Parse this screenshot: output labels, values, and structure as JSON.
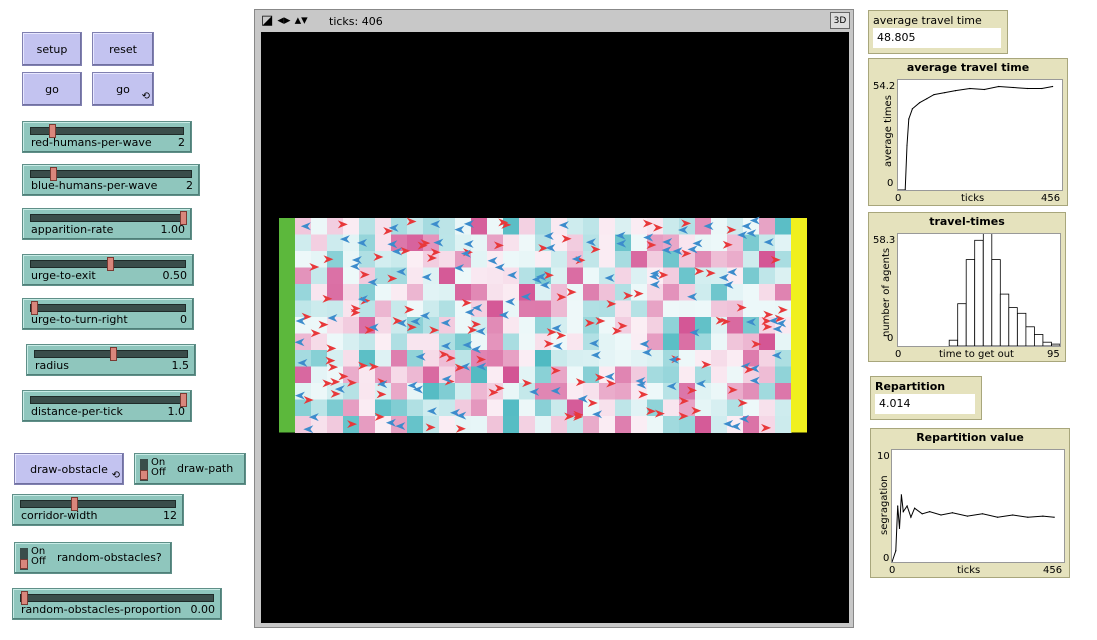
{
  "buttons": {
    "setup": "setup",
    "reset": "reset",
    "go_once": "go",
    "go_forever": "go",
    "draw_obstacle": "draw-obstacle",
    "forever_glyph": "⟲"
  },
  "sliders": [
    {
      "id": "red-humans-per-wave",
      "label": "red-humans-per-wave",
      "value": "2",
      "fraction": 0.12
    },
    {
      "id": "blue-humans-per-wave",
      "label": "blue-humans-per-wave",
      "value": "2",
      "fraction": 0.12
    },
    {
      "id": "apparition-rate",
      "label": "apparition-rate",
      "value": "1.00",
      "fraction": 1.0
    },
    {
      "id": "urge-to-exit",
      "label": "urge-to-exit",
      "value": "0.50",
      "fraction": 0.5
    },
    {
      "id": "urge-to-turn-right",
      "label": "urge-to-turn-right",
      "value": "0",
      "fraction": 0.0
    },
    {
      "id": "radius",
      "label": "radius",
      "value": "1.5",
      "fraction": 0.5
    },
    {
      "id": "distance-per-tick",
      "label": "distance-per-tick",
      "value": "1.0",
      "fraction": 1.0
    },
    {
      "id": "corridor-width",
      "label": "corridor-width",
      "value": "12",
      "fraction": 0.33
    },
    {
      "id": "random-obstacles-proportion",
      "label": "random-obstacles-proportion",
      "value": "0.00",
      "fraction": 0.0
    }
  ],
  "switches": {
    "draw_path": {
      "label": "draw-path",
      "on": "On",
      "off": "Off"
    },
    "random_obstacles": {
      "label": "random-obstacles?",
      "on": "On",
      "off": "Off"
    }
  },
  "view": {
    "ticks": "ticks: 406",
    "three_d": "3D",
    "controls": "◪ ◂▸ ▴▾"
  },
  "monitors": {
    "avg_travel": {
      "label": "average travel time",
      "value": "48.805"
    },
    "repartition": {
      "label": "Repartition value",
      "value": "4.014"
    }
  },
  "plots": {
    "avg_travel": {
      "title": "average travel time",
      "ylabel": "average times",
      "xlabel": "ticks",
      "ymax": "54.2",
      "ymin": "0",
      "xmin": "0",
      "xmax": "456"
    },
    "travel_times": {
      "title": "travel-times",
      "ylabel": "number of agents",
      "xlabel": "time to get out",
      "ymax": "58.3",
      "ymin": "0",
      "xmin": "0",
      "xmax": "95"
    },
    "repartition": {
      "title": "Repartition value",
      "ylabel": "segragation",
      "xlabel": "ticks",
      "ymax": "10",
      "ymin": "0",
      "xmin": "0",
      "xmax": "456"
    }
  },
  "colors": {
    "button": "#c3c3f0",
    "slider": "#8fc6bd",
    "monitor": "#e5e2bd",
    "world_bg": "#000000",
    "left_wall": "#5cb83c",
    "right_wall": "#f0f01e",
    "red_agent": "#e8383a",
    "blue_agent": "#3c8ccc"
  },
  "chart_data": [
    {
      "type": "line",
      "title": "average travel time",
      "xlabel": "ticks",
      "ylabel": "average times",
      "xlim": [
        0,
        456
      ],
      "ylim": [
        0,
        54.2
      ],
      "series": [
        {
          "x": [
            0,
            20,
            25,
            30,
            40,
            60,
            80,
            100,
            130,
            160,
            200,
            240,
            280,
            320,
            360,
            400,
            430
          ],
          "y": [
            0,
            0,
            22,
            35,
            40,
            43,
            45,
            47,
            48,
            49,
            50,
            49.5,
            51,
            50.5,
            50,
            50,
            51
          ]
        }
      ]
    },
    {
      "type": "bar",
      "title": "travel-times",
      "xlabel": "time to get out",
      "ylabel": "number of agents",
      "xlim": [
        0,
        95
      ],
      "ylim": [
        0,
        58.3
      ],
      "categories": [
        30,
        35,
        40,
        45,
        50,
        55,
        60,
        65,
        70,
        75,
        80,
        85,
        90
      ],
      "values": [
        3,
        22,
        45,
        55,
        62,
        45,
        27,
        20,
        17,
        10,
        6,
        2,
        1
      ]
    },
    {
      "type": "line",
      "title": "Repartition value",
      "xlabel": "ticks",
      "ylabel": "segragation",
      "xlim": [
        0,
        456
      ],
      "ylim": [
        0,
        10
      ],
      "series": [
        {
          "x": [
            0,
            10,
            15,
            20,
            25,
            30,
            40,
            50,
            60,
            80,
            100,
            130,
            160,
            200,
            240,
            280,
            320,
            360,
            400,
            430
          ],
          "y": [
            0,
            1,
            5,
            3,
            6,
            4.5,
            5,
            4,
            4.8,
            4.3,
            4.5,
            4.2,
            4.4,
            4.1,
            4.3,
            4,
            4.2,
            4,
            4.1,
            4
          ]
        }
      ]
    }
  ]
}
